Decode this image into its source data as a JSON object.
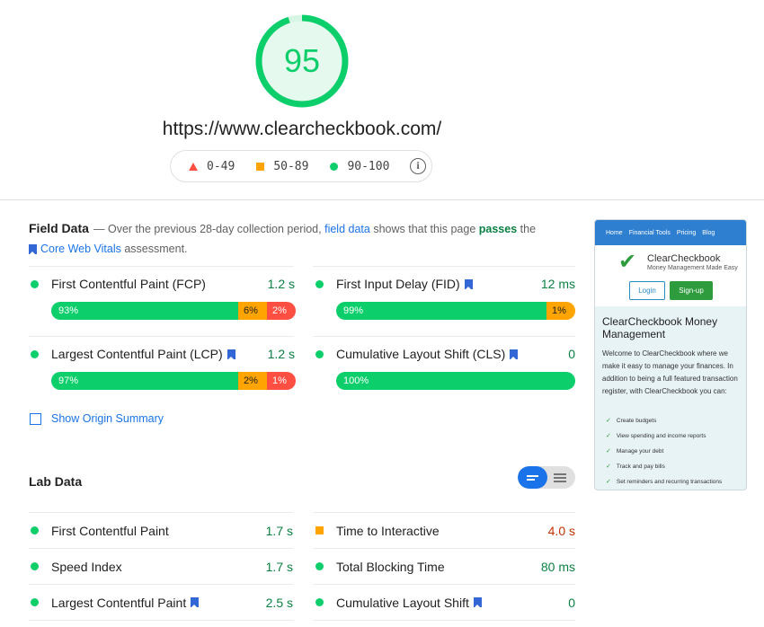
{
  "report": {
    "score": "95",
    "url": "https://www.clearcheckbook.com/",
    "score_color": "#0cce6b"
  },
  "legend": {
    "poor": "0-49",
    "average": "50-89",
    "good": "90-100",
    "info_icon": "info-icon"
  },
  "field_data": {
    "title": "Field Data",
    "desc_prefix": "— Over the previous 28-day collection period,",
    "desc_link": "field data",
    "desc_mid": "shows that this page",
    "desc_pass": "passes",
    "desc_the": "the",
    "cwv_link": "Core Web Vitals",
    "desc_end": "assessment.",
    "metrics": [
      {
        "name": "First Contentful Paint (FCP)",
        "value": "1.2 s",
        "good": "93%",
        "avg": "6%",
        "poor": "2%",
        "good_pct": 93,
        "avg_pct": 6,
        "poor_pct": 2
      },
      {
        "name": "First Input Delay (FID)",
        "value": "12 ms",
        "good": "99%",
        "avg": "1%",
        "good_pct": 99,
        "avg_pct": 1
      },
      {
        "name": "Largest Contentful Paint (LCP)",
        "value": "1.2 s",
        "good": "97%",
        "avg": "2%",
        "poor": "1%",
        "good_pct": 97,
        "avg_pct": 2,
        "poor_pct": 1
      },
      {
        "name": "Cumulative Layout Shift (CLS)",
        "value": "0",
        "good": "100%",
        "good_pct": 100
      }
    ],
    "origin_summary": "Show Origin Summary"
  },
  "lab_data": {
    "title": "Lab Data",
    "metrics": [
      {
        "name": "First Contentful Paint",
        "value": "1.7 s"
      },
      {
        "name": "Time to Interactive",
        "value": "4.0 s"
      },
      {
        "name": "Speed Index",
        "value": "1.7 s"
      },
      {
        "name": "Total Blocking Time",
        "value": "80 ms"
      },
      {
        "name": "Largest Contentful Paint",
        "value": "2.5 s"
      },
      {
        "name": "Cumulative Layout Shift",
        "value": "0"
      }
    ]
  },
  "thumbnail": {
    "nav": [
      "Home",
      "Financial Tools",
      "Pricing",
      "Blog"
    ],
    "brand": "ClearCheckbook",
    "tagline": "Money Management Made Easy",
    "login": "Login",
    "signup": "Sign-up",
    "heading": "ClearCheckbook Money Management",
    "paragraph": "Welcome to ClearCheckbook where we make it easy to manage your finances. In addition to being a full featured transaction register, with ClearCheckbook you can:",
    "features": [
      "Create budgets",
      "View spending and income reports",
      "Manage your debt",
      "Track and pay bills",
      "Set reminders and recurring transactions"
    ]
  },
  "colors": {
    "good": "#0cce6b",
    "average": "#ffa400",
    "poor": "#ff4e42",
    "link": "#1a73e8"
  }
}
